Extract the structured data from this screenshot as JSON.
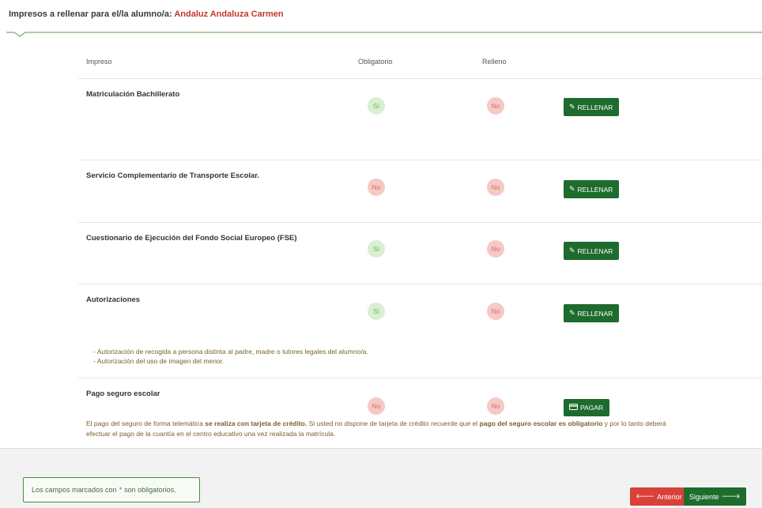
{
  "header": {
    "prefix": "Impresos a rellenar para el/la alumno/a:",
    "student_name": "Andaluz Andaluza Carmen"
  },
  "columns": {
    "impreso": "Impreso",
    "obligatorio": "Obligatorio",
    "relleno": "Relleno"
  },
  "forms": [
    {
      "title": "Matriculación Bachillerato",
      "obligatorio": "Sí",
      "relleno": "No",
      "action": "RELLENAR"
    },
    {
      "title": "Servicio Complementario de Transporte Escolar.",
      "obligatorio": "No",
      "relleno": "No",
      "action": "RELLENAR"
    },
    {
      "title": "Cuestionario de Ejecución del Fondo Social Europeo (FSE)",
      "obligatorio": "Sí",
      "relleno": "No",
      "action": "RELLENAR"
    },
    {
      "title": "Autorizaciones",
      "obligatorio": "Sí",
      "relleno": "No",
      "action": "RELLENAR",
      "notes": [
        "- Autorización de recogida a persona distinta al padre, madre o tutores legales del alumno/a.",
        "- Autorización del uso de imagen del menor."
      ]
    },
    {
      "title": "Pago seguro escolar",
      "obligatorio": "No",
      "relleno": "No",
      "action": "PAGAR"
    }
  ],
  "payment_note": {
    "p1": "El pago del seguro de forma telemática ",
    "b1": "se realiza con tarjeta de crédito.",
    "p2": " Si usted no dispone de tarjeta de crédito recuerde que el ",
    "b2": "pago del seguro escolar es obligatorio",
    "p3": " y por lo tanto deberá",
    "line2": "efectuar el pago de la cuantía en el centro educativo una vez realizada la matrícula."
  },
  "footer": {
    "required_pre": "Los campos marcados con",
    "required_star": "*",
    "required_post": "son obligatorios.",
    "prev_label": "Anterior",
    "next_label": "Siguiente"
  },
  "colors": {
    "accent_green": "#1e6b2e",
    "danger_red": "#d9413a",
    "student_red": "#c0392b"
  }
}
